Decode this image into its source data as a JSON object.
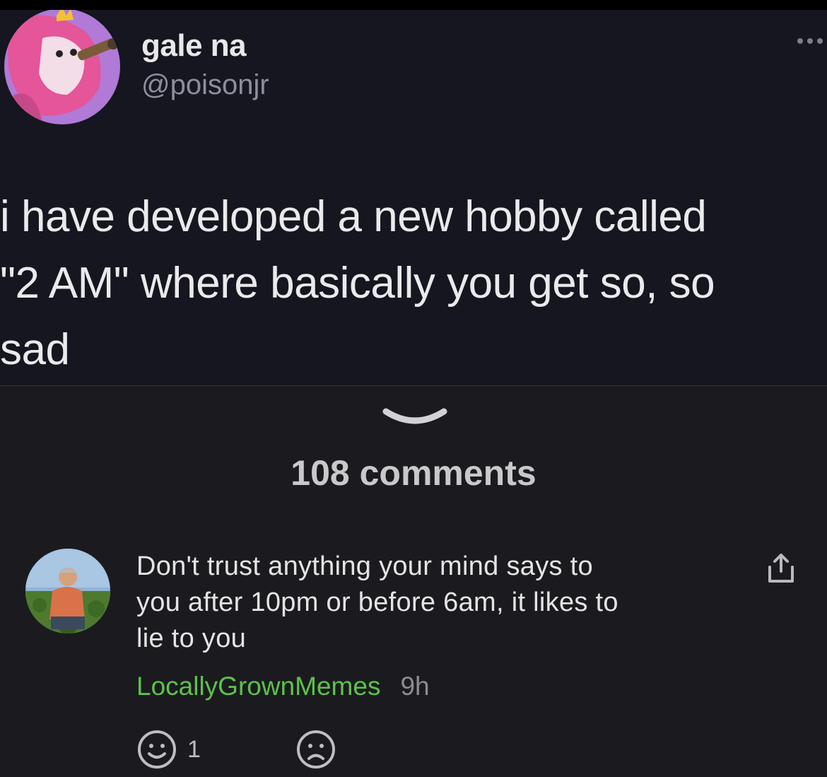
{
  "tweet": {
    "display_name": "gale na",
    "handle": "@poisonjr",
    "text": "i have developed a new hobby called\n\"2 AM\" where basically you get so, so\nsad"
  },
  "comments_section": {
    "count_label": "108 comments"
  },
  "comment": {
    "text": "Don't trust anything your mind says to\nyou after 10pm or before 6am, it likes to\nlie to you",
    "author": "LocallyGrownMemes",
    "time": "9h",
    "happy_count": "1"
  },
  "icons": {
    "more": "more-dots-icon",
    "collapse": "chevron-down-icon",
    "share": "share-icon",
    "happy": "smiley-icon",
    "sad": "frown-icon"
  },
  "colors": {
    "author": "#5dc24a",
    "tweet_bg": "#15161f",
    "page_bg": "#1b1b1f"
  }
}
